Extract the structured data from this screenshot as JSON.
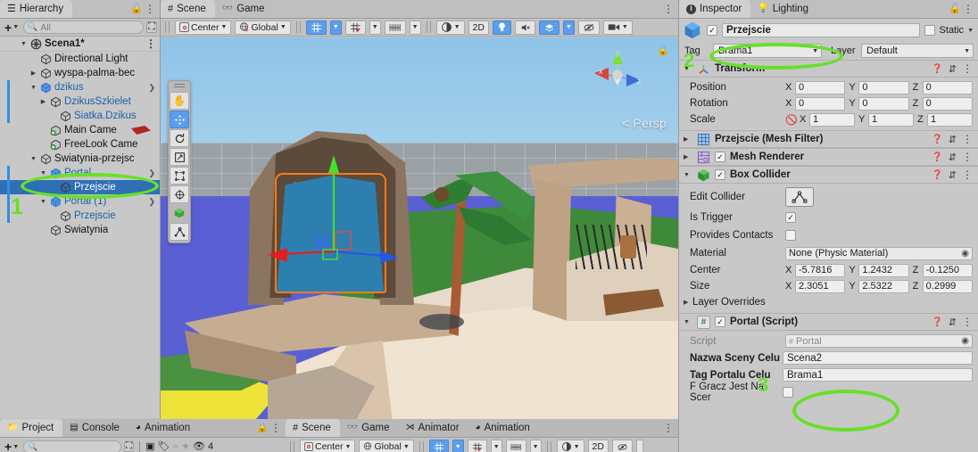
{
  "hierarchy": {
    "tab_label": "Hierarchy",
    "tab_icon": "list-icon",
    "lock_icon": "lock-open-icon",
    "menu_icon": "kebab-menu-icon",
    "add_label": "+",
    "search_placeholder": "All",
    "scene_name": "Scena1*",
    "items": [
      {
        "label": "Directional Light",
        "indent": 2,
        "expand": "none",
        "kind": "gameobject"
      },
      {
        "label": "wyspa-palma-bec",
        "indent": 2,
        "expand": "collapsed",
        "kind": "gameobject"
      },
      {
        "label": "dzikus",
        "indent": 2,
        "expand": "expanded",
        "kind": "prefab"
      },
      {
        "label": "DzikusSzkielet",
        "indent": 3,
        "expand": "collapsed",
        "kind": "prefab-child"
      },
      {
        "label": "Siatka.Dzikus",
        "indent": 4,
        "expand": "none",
        "kind": "prefab-child"
      },
      {
        "label": "Main Came",
        "indent": 3,
        "expand": "none",
        "kind": "camera"
      },
      {
        "label": "FreeLook Came",
        "indent": 3,
        "expand": "none",
        "kind": "camera"
      },
      {
        "label": "Swiatynia-przejsc",
        "indent": 2,
        "expand": "expanded",
        "kind": "gameobject"
      },
      {
        "label": "Portal",
        "indent": 3,
        "expand": "expanded",
        "kind": "prefab"
      },
      {
        "label": "Przejscie",
        "indent": 4,
        "expand": "none",
        "kind": "prefab-child",
        "selected": true
      },
      {
        "label": "Portal (1)",
        "indent": 3,
        "expand": "expanded",
        "kind": "prefab"
      },
      {
        "label": "Przejscie",
        "indent": 4,
        "expand": "none",
        "kind": "prefab-child"
      },
      {
        "label": "Swiatynia",
        "indent": 3,
        "expand": "none",
        "kind": "gameobject"
      }
    ]
  },
  "scene_view": {
    "tabs": [
      {
        "label": "Scene",
        "icon": "grid-icon",
        "active": true
      },
      {
        "label": "Game",
        "icon": "gamepad-icon",
        "active": false
      }
    ],
    "menu_icon": "kebab-menu-icon",
    "toolbar": {
      "pivot_mode": "Center",
      "pivot_icon": "pivot-center-icon",
      "handle_space": "Global",
      "space_icon": "globe-icon",
      "grid_snap_icon": "grid-snap-icon",
      "snap_increment_icon": "snap-increment-icon",
      "grid_size_icon": "grid-ruler-icon",
      "shading_icon": "shading-mode-icon",
      "view_2d_label": "2D",
      "lighting_icon": "lightbulb-icon",
      "audio_icon": "audio-mute-icon",
      "fx_icon": "effects-layers-icon",
      "gizmos_icon": "gizmos-hidden-icon",
      "camera_icon": "scene-camera-icon"
    },
    "left_tools": [
      {
        "icon": "hand-tool-icon",
        "selected": false
      },
      {
        "icon": "move-tool-icon",
        "selected": true
      },
      {
        "icon": "rotate-tool-icon",
        "selected": false
      },
      {
        "icon": "scale-tool-icon",
        "selected": false
      },
      {
        "icon": "rect-tool-icon",
        "selected": false
      },
      {
        "icon": "transform-tool-icon",
        "selected": false
      },
      {
        "icon": "custom-editor-tool-icon",
        "selected": false
      },
      {
        "icon": "component-tool-icon",
        "selected": false
      }
    ],
    "orientation_gizmo": {
      "projection_label": "Persp",
      "projection_prefix": "<",
      "axis_x": "x",
      "axis_y": "y",
      "axis_z": "z",
      "lock_icon": "lock-closed-icon",
      "color_x": "#d8453b",
      "color_y": "#7ae03d",
      "color_z": "#3b6fd8"
    }
  },
  "inspector": {
    "tabs": [
      {
        "label": "Inspector",
        "icon": "info-icon",
        "active": true
      },
      {
        "label": "Lighting",
        "icon": "lightbulb-icon",
        "active": false
      }
    ],
    "lock_icon": "lock-open-icon",
    "menu_icon": "kebab-menu-icon",
    "object": {
      "enabled": true,
      "name": "Przejscie",
      "icon": "prefab-cube-icon",
      "static_label": "Static",
      "static_checked": false,
      "tag_label": "Tag",
      "tag_value": "Brama1",
      "layer_label": "Layer",
      "layer_value": "Default"
    },
    "components": [
      {
        "id": "transform",
        "title": "Transform",
        "icon": "transform-axes-icon",
        "expanded": true,
        "has_checkbox": false,
        "help_icon": "help-icon",
        "preset_icon": "preset-icon",
        "menu_icon": "kebab-menu-icon",
        "rows": [
          {
            "label": "Position",
            "x": "0",
            "y": "0",
            "z": "0"
          },
          {
            "label": "Rotation",
            "x": "0",
            "y": "0",
            "z": "0"
          },
          {
            "label": "Scale",
            "x": "1",
            "y": "1",
            "z": "1",
            "link_icon": "constrain-proportions-off-icon"
          }
        ]
      },
      {
        "id": "mesh-filter",
        "title": "Przejscie (Mesh Filter)",
        "icon": "mesh-filter-icon",
        "expanded": false,
        "has_checkbox": false
      },
      {
        "id": "mesh-renderer",
        "title": "Mesh Renderer",
        "icon": "mesh-renderer-icon",
        "expanded": false,
        "has_checkbox": true,
        "checked": true
      },
      {
        "id": "box-collider",
        "title": "Box Collider",
        "icon": "box-collider-icon",
        "expanded": true,
        "has_checkbox": true,
        "checked": true,
        "fields": {
          "edit_collider_label": "Edit Collider",
          "edit_collider_icon": "edit-collider-icon",
          "is_trigger_label": "Is Trigger",
          "is_trigger_checked": true,
          "provides_contacts_label": "Provides Contacts",
          "provides_contacts_checked": false,
          "material_label": "Material",
          "material_value": "None (Physic Material)",
          "center_label": "Center",
          "center": {
            "x": "-5.7816",
            "y": "1.2432",
            "z": "-0.1250"
          },
          "size_label": "Size",
          "size": {
            "x": "2.3051",
            "y": "2.5322",
            "z": "0.2999"
          },
          "layer_overrides_label": "Layer Overrides"
        }
      },
      {
        "id": "portal-script",
        "title": "Portal (Script)",
        "icon": "script-icon",
        "expanded": true,
        "has_checkbox": true,
        "checked": true,
        "fields": {
          "script_label": "Script",
          "script_value": "Portal",
          "scene_name_label": "Nazwa Sceny Celu",
          "scene_name_value": "Scena2",
          "portal_tag_label": "Tag Portalu Celu",
          "portal_tag_value": "Brama1",
          "player_on_scene_label": "F Gracz Jest Na Scer",
          "player_on_scene_checked": false
        }
      }
    ]
  },
  "bottom_dock": {
    "left_tabs": [
      {
        "label": "Project",
        "icon": "folder-icon",
        "active": true
      },
      {
        "label": "Console",
        "icon": "console-icon",
        "active": false
      },
      {
        "label": "Animation",
        "icon": "clock-icon",
        "active": false
      }
    ],
    "left_lock_icon": "lock-closed-icon",
    "left_menu_icon": "kebab-menu-icon",
    "project_toolbar": {
      "add_label": "+",
      "search_placeholder": "",
      "search_icon": "search-icon",
      "save_search_icon": "save-search-icon",
      "type_filter_icon": "object-filter-icon",
      "label_filter_icon": "label-filter-icon",
      "circle_icon": "circle-icon",
      "favorite_icon": "star-icon",
      "hidden_icon": "hidden-eye-icon",
      "hidden_count": "4"
    },
    "right_tabs": [
      {
        "label": "Scene",
        "icon": "grid-icon",
        "active": true
      },
      {
        "label": "Game",
        "icon": "gamepad-icon",
        "active": false
      },
      {
        "label": "Animator",
        "icon": "animator-icon",
        "active": false
      },
      {
        "label": "Animation",
        "icon": "clock-icon",
        "active": false
      }
    ],
    "right_menu_icon": "kebab-menu-icon",
    "right_toolbar": {
      "pivot_mode": "Center",
      "handle_space": "Global",
      "view_2d_label": "2D"
    }
  },
  "annotations": {
    "accent_color": "#67e028",
    "markers": [
      {
        "number": "1",
        "target": "hierarchy-selected-przejscie"
      },
      {
        "number": "2",
        "target": "inspector-tag-dropdown"
      },
      {
        "number": "3",
        "target": "portal-script-fields"
      }
    ]
  }
}
